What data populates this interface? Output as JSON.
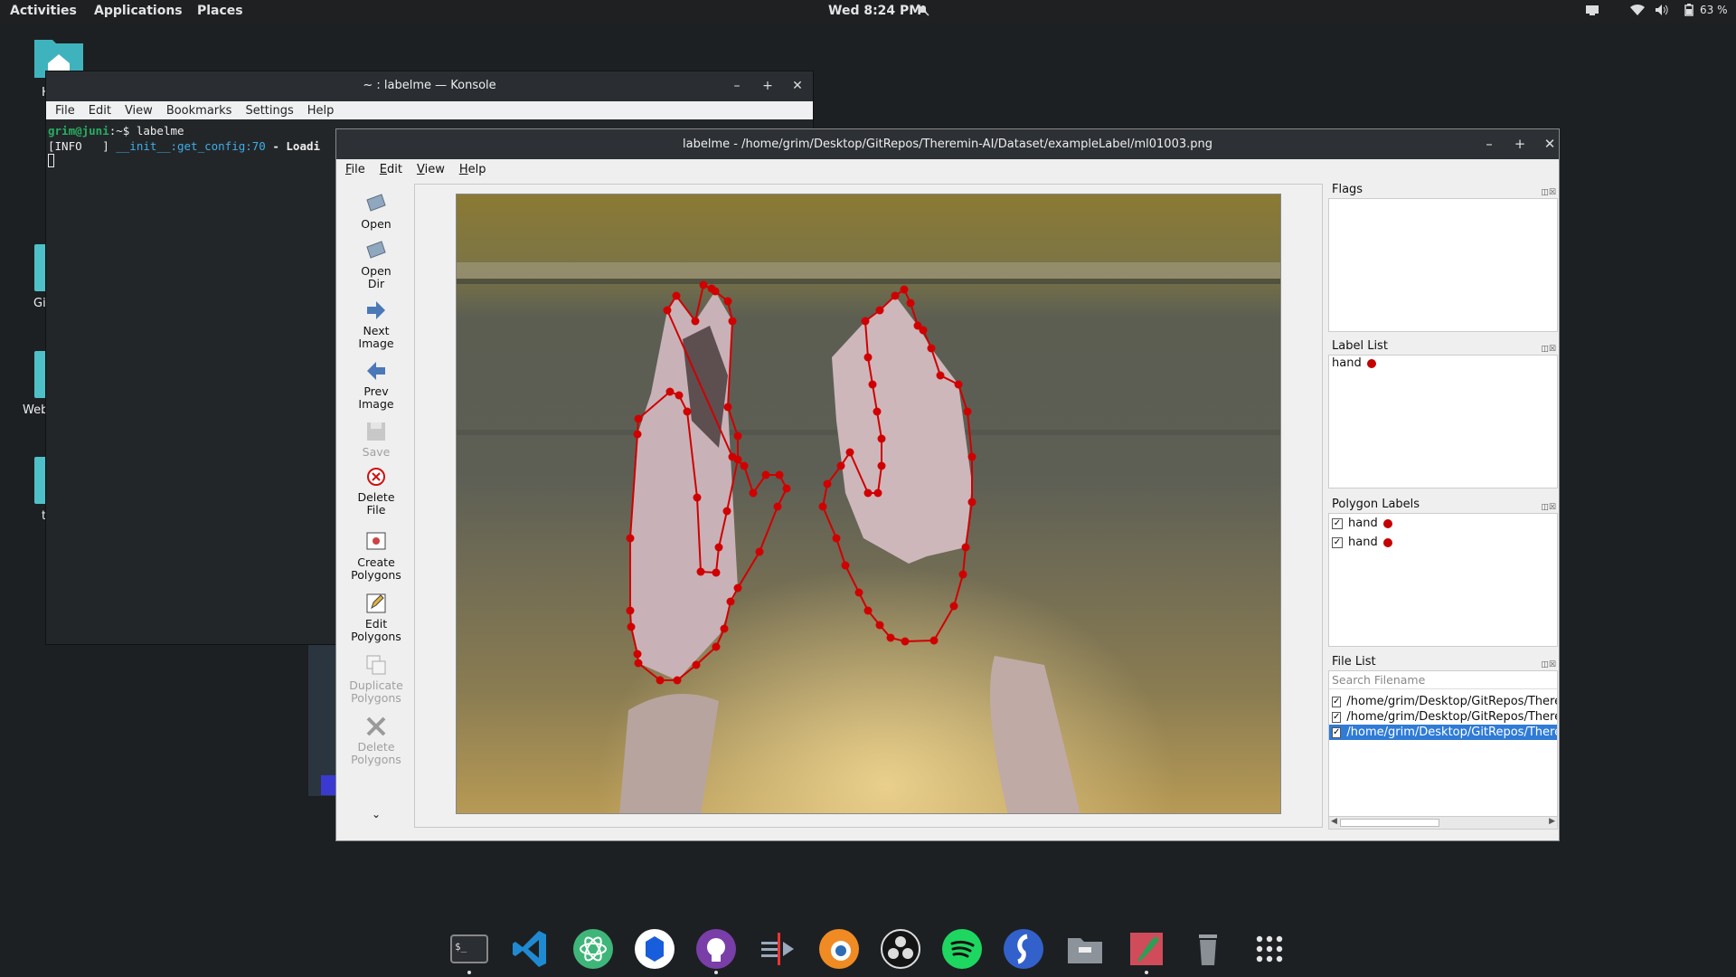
{
  "topbar": {
    "activities": "Activities",
    "applications": "Applications",
    "places": "Places",
    "clock": "Wed  8:24 PM",
    "battery": "63 %"
  },
  "desktop": {
    "labels": [
      "H",
      "Gi",
      "Web",
      "t"
    ]
  },
  "konsole": {
    "title": "~ : labelme — Konsole",
    "menu": [
      "File",
      "Edit",
      "View",
      "Bookmarks",
      "Settings",
      "Help"
    ],
    "prompt_user": "grim@juni",
    "prompt_path": ":~$ ",
    "command": "labelme",
    "log_level": "[INFO   ]",
    "log_module": " __init__:get_config:70",
    "log_text": " - Loadi"
  },
  "labelme": {
    "title": "labelme - /home/grim/Desktop/GitRepos/Theremin-AI/Dataset/exampleLabel/ml01003.png",
    "menu": [
      "File",
      "Edit",
      "View",
      "Help"
    ],
    "tools": {
      "open": "Open",
      "open_dir_1": "Open",
      "open_dir_2": "Dir",
      "next_1": "Next",
      "next_2": "Image",
      "prev_1": "Prev",
      "prev_2": "Image",
      "save": "Save",
      "delete_file_1": "Delete",
      "delete_file_2": "File",
      "create_1": "Create",
      "create_2": "Polygons",
      "edit_1": "Edit",
      "edit_2": "Polygons",
      "dup_1": "Duplicate",
      "dup_2": "Polygons",
      "delpoly_1": "Delete",
      "delpoly_2": "Polygons",
      "more": "⌄"
    },
    "flags_title": "Flags",
    "label_list_title": "Label List",
    "label_list": [
      {
        "name": "hand",
        "color": "#c40000"
      }
    ],
    "polygon_labels_title": "Polygon Labels",
    "polygon_labels": [
      {
        "name": "hand",
        "checked": true,
        "color": "#c40000"
      },
      {
        "name": "hand",
        "checked": true,
        "color": "#c40000"
      }
    ],
    "file_list_title": "File List",
    "search_placeholder": "Search Filename",
    "files": [
      {
        "path": "/home/grim/Desktop/GitRepos/Theremin",
        "checked": true,
        "selected": false
      },
      {
        "path": "/home/grim/Desktop/GitRepos/Theremin",
        "checked": true,
        "selected": false
      },
      {
        "path": "/home/grim/Desktop/GitRepos/Theremin",
        "checked": true,
        "selected": true
      }
    ]
  },
  "dock": {
    "apps": [
      "terminal-icon",
      "vscode-icon",
      "atom-icon",
      "bitwarden-icon",
      "github-desktop-icon",
      "kdenlive-icon",
      "blender-icon",
      "obs-icon",
      "spotify-icon",
      "simplenote-icon",
      "files-icon",
      "krita-icon",
      "trash-icon",
      "app-grid-icon"
    ]
  }
}
